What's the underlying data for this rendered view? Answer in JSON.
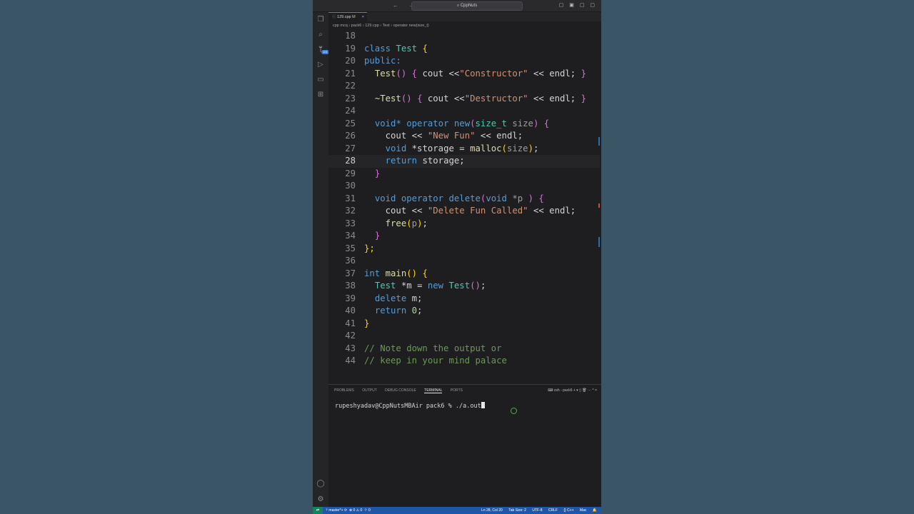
{
  "titlebar": {
    "nav": "← →",
    "command_center": "CppNuts",
    "layout_icons": "▢ ▣ ▢ ▢"
  },
  "activity": {
    "scm_badge": "101"
  },
  "tab": {
    "filename": "129.cpp",
    "modified": "M",
    "close": "×"
  },
  "breadcrumb": "cpp mcq  ›  pack6  ›  129.cpp  ›  Test  ›  operator new(size_t)",
  "editor": {
    "lines": [
      {
        "n": "18"
      },
      {
        "n": "19"
      },
      {
        "n": "20"
      },
      {
        "n": "21"
      },
      {
        "n": "22"
      },
      {
        "n": "23"
      },
      {
        "n": "24"
      },
      {
        "n": "25"
      },
      {
        "n": "26"
      },
      {
        "n": "27"
      },
      {
        "n": "28"
      },
      {
        "n": "29"
      },
      {
        "n": "30"
      },
      {
        "n": "31"
      },
      {
        "n": "32"
      },
      {
        "n": "33"
      },
      {
        "n": "34"
      },
      {
        "n": "35"
      },
      {
        "n": "36"
      },
      {
        "n": "37"
      },
      {
        "n": "38"
      },
      {
        "n": "39"
      },
      {
        "n": "40"
      },
      {
        "n": "41"
      },
      {
        "n": "42"
      },
      {
        "n": "43"
      },
      {
        "n": "44"
      }
    ],
    "tokens": {
      "class": "class",
      "Test": "Test",
      "lbrace": "{",
      "public": "public:",
      "ctor": "Test",
      "parens": "()",
      "cout": "cout",
      "shl": "<<",
      "endl": "endl;",
      "s_constructor": "\"Constructor\"",
      "rbrace": "}",
      "dtor": "~Test",
      "s_destructor": "\"Destructor\"",
      "void": "void",
      "star": "*",
      "operator": "operator",
      "new": "new",
      "lparen": "(",
      "size_t": "size_t",
      "size": "size",
      "rparen": ")",
      "s_newfun": "\"New Fun\"",
      "storage_decl": "*storage",
      "eq": "=",
      "malloc": "malloc",
      "semi": ";",
      "return": "return",
      "storage": "storage;",
      "delete": "delete",
      "p_ptr": "*p",
      "s_deletefun": "\"Delete Fun Called\"",
      "free": "free",
      "p": "p",
      "close_class": "};",
      "int": "int",
      "main": "main",
      "m_ptr": "*m",
      "new_kw": "new",
      "delete_kw": "delete",
      "m_semi": "m;",
      "zero": "0",
      "comment1": "// Note down the output or",
      "comment2": "// keep in your mind palace"
    }
  },
  "panel": {
    "tabs": [
      "PROBLEMS",
      "OUTPUT",
      "DEBUG CONSOLE",
      "TERMINAL",
      "PORTS"
    ],
    "active_tab": "TERMINAL",
    "shell": "zsh - pack6",
    "controls": "+ ▾  ▯  🗑  ···  ^  ×",
    "prompt": "rupeshyadav@CppNutsMBAir pack6 % ./a.out"
  },
  "statusbar": {
    "branch": "master*+",
    "sync": "⟳",
    "errors": "⊗ 0 ⚠ 0",
    "ports": "⚐ 0",
    "position": "Ln 28, Col 20",
    "tab_size": "Tab Size: 2",
    "encoding": "UTF-8",
    "eol": "CRLF",
    "language": "{} C++",
    "platform": "Mac"
  }
}
